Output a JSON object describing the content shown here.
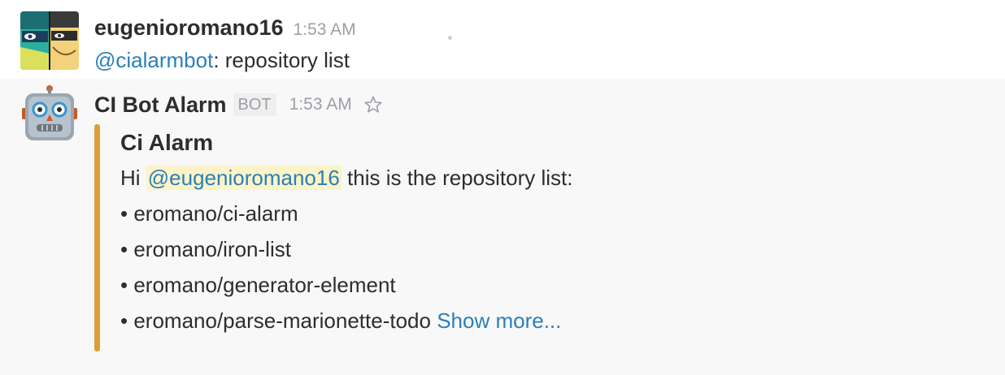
{
  "messages": [
    {
      "username": "eugenioromano16",
      "time": "1:53 AM",
      "mention": "@cialarmbot",
      "text": ": repository list"
    },
    {
      "username": "CI Bot Alarm",
      "badge": "BOT",
      "time": "1:53 AM",
      "attachment": {
        "title": "Ci Alarm",
        "intro_prefix": "Hi ",
        "intro_mention": "@eugenioromano16",
        "intro_suffix": " this is the repository list:",
        "items": [
          "• eromano/ci-alarm",
          "• eromano/iron-list",
          "• eromano/generator-element",
          "• eromano/parse-marionette-todo"
        ],
        "show_more": "Show more...",
        "bar_color": "#daa038"
      }
    }
  ],
  "colors": {
    "mention": "#2a80b9",
    "mention_highlight": "#fcf3c8",
    "timestamp": "#9e9ea6"
  },
  "icons": {
    "user_avatar": "comic-masked-faces-avatar",
    "bot_avatar": "robot-face-avatar",
    "star": "star-outline-icon"
  }
}
